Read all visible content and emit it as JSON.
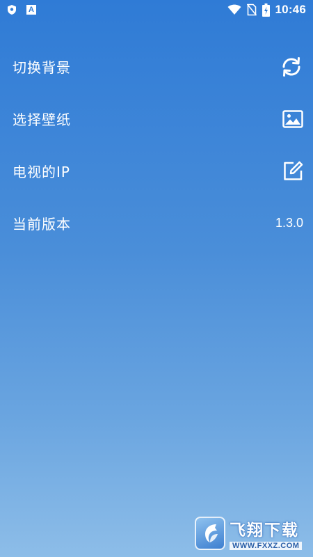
{
  "status_bar": {
    "left_icons": [
      "shield-icon",
      "app-a-icon"
    ],
    "app_icon_letter": "A",
    "right_icons": [
      "wifi-icon",
      "no-sim-icon",
      "battery-charging-icon"
    ],
    "time": "10:46"
  },
  "settings": [
    {
      "label": "切换背景",
      "trailing_icon": "refresh-icon"
    },
    {
      "label": "选择壁纸",
      "trailing_icon": "image-icon"
    },
    {
      "label": "电视的IP",
      "trailing_icon": "edit-icon"
    },
    {
      "label": "当前版本",
      "value": "1.3.0"
    }
  ],
  "watermark": {
    "title": "飞翔下载",
    "url": "WWW.FXXZ.COM"
  },
  "colors": {
    "background_top": "#2f7bd6",
    "background_bottom": "#8dbde8",
    "text": "#ffffff"
  }
}
